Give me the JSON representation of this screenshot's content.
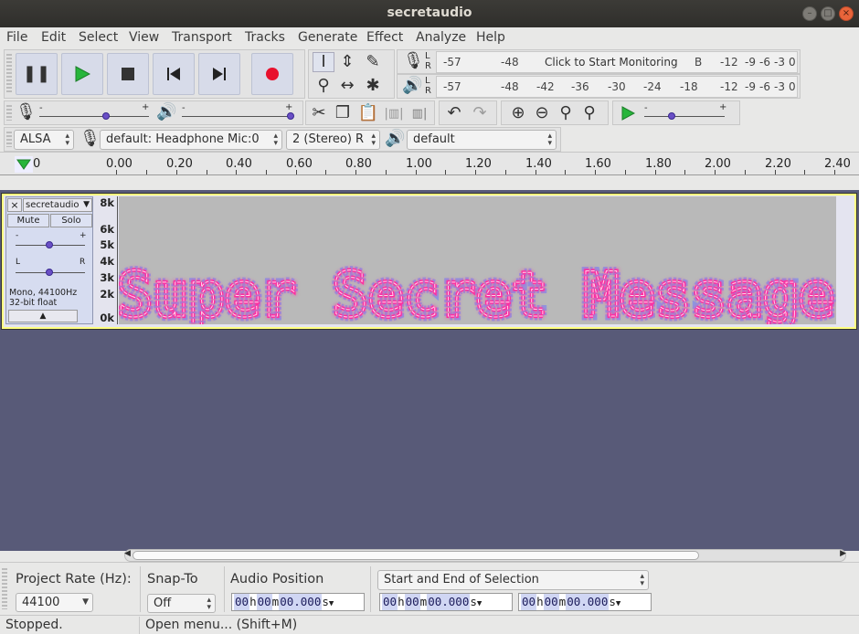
{
  "window": {
    "title": "secretaudio"
  },
  "menu": [
    "File",
    "Edit",
    "Select",
    "View",
    "Transport",
    "Tracks",
    "Generate",
    "Effect",
    "Analyze",
    "Help"
  ],
  "meters": {
    "record_ticks": [
      "-57",
      "-48",
      "Click to Start Monitoring",
      "-12",
      "-9",
      "-6",
      "-3",
      "0"
    ],
    "play_ticks": [
      "-57",
      "-48",
      "-42",
      "-36",
      "-30",
      "-24",
      "-18",
      "-12",
      "-9",
      "-6",
      "-3",
      "0"
    ],
    "channel_L": "L",
    "channel_R": "R",
    "rec_hidden_tick": "B"
  },
  "device": {
    "host": "ALSA",
    "input_device": "default: Headphone Mic:0",
    "channels": "2 (Stereo) R",
    "output_device": "default"
  },
  "ruler": {
    "labels": [
      "0",
      "0.00",
      "0.20",
      "0.40",
      "0.60",
      "0.80",
      "1.00",
      "1.20",
      "1.40",
      "1.60",
      "1.80",
      "2.00",
      "2.20",
      "2.40"
    ]
  },
  "track": {
    "close": "×",
    "name": "secretaudio",
    "mute": "Mute",
    "solo": "Solo",
    "gain_min": "-",
    "gain_max": "+",
    "pan_left": "L",
    "pan_right": "R",
    "info_line1": "Mono, 44100Hz",
    "info_line2": "32-bit float",
    "freq_labels": [
      "8k",
      "6k",
      "5k",
      "4k",
      "3k",
      "2k",
      "0k"
    ],
    "spectrogram_text": "Super Secret Message"
  },
  "selection": {
    "project_rate_label": "Project Rate (Hz):",
    "project_rate": "44100",
    "snap_to_label": "Snap-To",
    "snap_to": "Off",
    "audio_position_label": "Audio Position",
    "selection_mode": "Start and End of Selection",
    "time_parts": [
      "00",
      "h",
      "00",
      "m",
      "00.000",
      "s"
    ]
  },
  "status": {
    "state": "Stopped.",
    "hint": "Open menu... (Shift+M)"
  },
  "colors": {
    "record": "#e8112d",
    "play": "#27b53b",
    "track_bg": "#585a78",
    "spectro_text": "#ff2fa0",
    "selection_border": "#ffff80"
  }
}
